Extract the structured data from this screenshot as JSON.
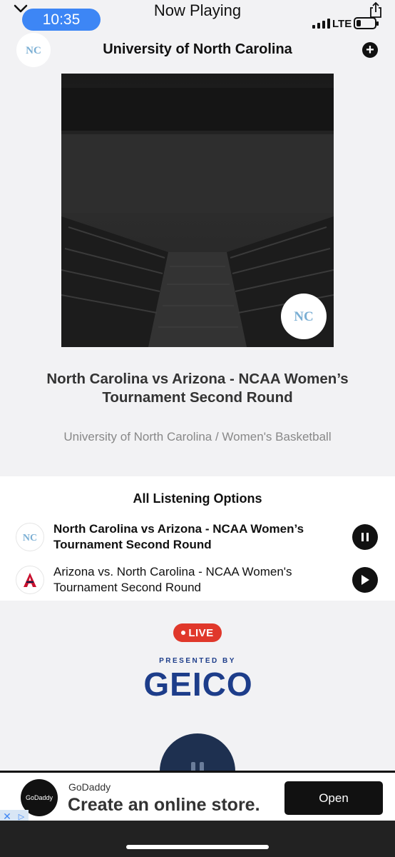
{
  "status": {
    "time": "10:35",
    "network": "LTE",
    "signal_bars": 4,
    "battery_level": 0.15
  },
  "screen": {
    "title": "Now Playing"
  },
  "station": {
    "name": "University of North Carolina"
  },
  "track": {
    "title": "North Carolina vs Arizona - NCAA Women’s Tournament Second Round",
    "subtitle": "University of North Carolina / Women's Basketball"
  },
  "listening_options": {
    "heading": "All Listening Options",
    "items": [
      {
        "label": "North Carolina vs Arizona - NCAA Women’s Tournament Second Round",
        "state": "playing",
        "logo": "unc-logo-icon"
      },
      {
        "label": "Arizona vs. North Carolina - NCAA Women's Tournament Second Round",
        "state": "paused",
        "logo": "arizona-logo-icon"
      }
    ]
  },
  "live": {
    "badge": "LIVE"
  },
  "sponsor": {
    "presented_by": "PRESENTED BY",
    "brand": "GEICO"
  },
  "ad": {
    "brand": "GoDaddy",
    "headline": "Create an online store.",
    "cta": "Open",
    "logo_text": "GoDaddy"
  },
  "colors": {
    "time_pill": "#3d86f5",
    "live": "#e0382b",
    "geico_blue": "#1d3d8a",
    "unc_blue": "#7bafd4"
  }
}
